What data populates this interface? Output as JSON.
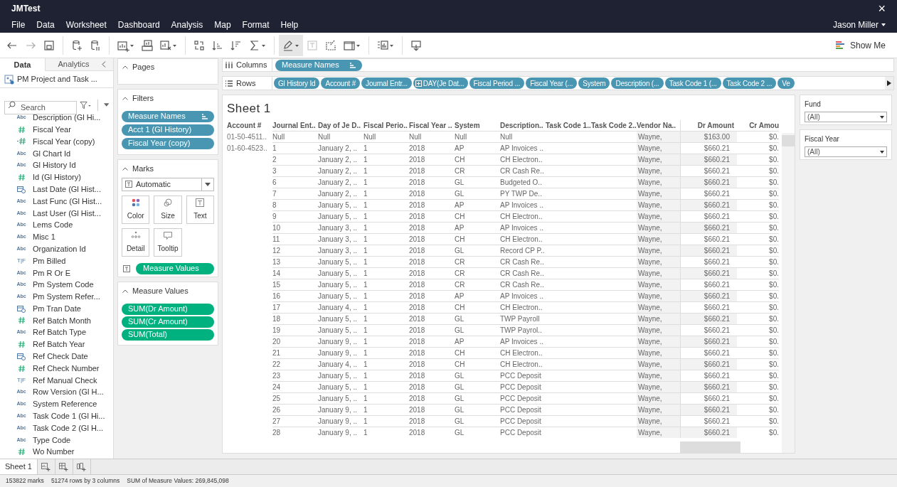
{
  "window": {
    "title": "JMTest",
    "close": "×"
  },
  "menu": [
    "File",
    "Data",
    "Worksheet",
    "Dashboard",
    "Analysis",
    "Map",
    "Format",
    "Help"
  ],
  "user": "Jason Miller",
  "show_me": "Show Me",
  "data_pane": {
    "tabs": [
      {
        "label": "Data",
        "selected": true
      },
      {
        "label": "Analytics",
        "selected": false
      }
    ],
    "datasource": "PM Project and Task ...",
    "search": {
      "placeholder": "Search"
    },
    "fields": [
      {
        "name": "Description (Gl Hi...",
        "kind": "string",
        "type_label": "Abc"
      },
      {
        "name": "Fiscal Year",
        "kind": "number"
      },
      {
        "name": "Fiscal Year (copy)",
        "kind": "calc"
      },
      {
        "name": "Gl Chart Id",
        "kind": "string",
        "type_label": "Abc"
      },
      {
        "name": "Gl History Id",
        "kind": "string",
        "type_label": "Abc"
      },
      {
        "name": "Id (Gl History)",
        "kind": "number"
      },
      {
        "name": "Last Date (Gl Hist...",
        "kind": "date"
      },
      {
        "name": "Last Func (Gl Hist...",
        "kind": "string",
        "type_label": "Abc"
      },
      {
        "name": "Last User (Gl Hist...",
        "kind": "string",
        "type_label": "Abc"
      },
      {
        "name": "Lems Code",
        "kind": "string",
        "type_label": "Abc"
      },
      {
        "name": "Misc 1",
        "kind": "string",
        "type_label": "Abc"
      },
      {
        "name": "Organization Id",
        "kind": "string",
        "type_label": "Abc"
      },
      {
        "name": "Pm Billed",
        "kind": "boolean",
        "type_label": "T|F"
      },
      {
        "name": "Pm R Or E",
        "kind": "string",
        "type_label": "Abc"
      },
      {
        "name": "Pm System Code",
        "kind": "string",
        "type_label": "Abc"
      },
      {
        "name": "Pm System Refer...",
        "kind": "string",
        "type_label": "Abc"
      },
      {
        "name": "Pm Tran Date",
        "kind": "date"
      },
      {
        "name": "Ref Batch Month",
        "kind": "number"
      },
      {
        "name": "Ref Batch Type",
        "kind": "string",
        "type_label": "Abc"
      },
      {
        "name": "Ref Batch Year",
        "kind": "number"
      },
      {
        "name": "Ref Check Date",
        "kind": "date"
      },
      {
        "name": "Ref Check Number",
        "kind": "number"
      },
      {
        "name": "Ref Manual Check",
        "kind": "boolean",
        "type_label": "T|F"
      },
      {
        "name": "Row Version (Gl H...",
        "kind": "string",
        "type_label": "Abc"
      },
      {
        "name": "System Reference",
        "kind": "string",
        "type_label": "Abc"
      },
      {
        "name": "Task Code 1 (Gl Hi...",
        "kind": "string",
        "type_label": "Abc"
      },
      {
        "name": "Task Code 2 (Gl H...",
        "kind": "string",
        "type_label": "Abc"
      },
      {
        "name": "Type Code",
        "kind": "string",
        "type_label": "Abc"
      },
      {
        "name": "Wo Number",
        "kind": "number"
      }
    ]
  },
  "pages": {
    "title": "Pages"
  },
  "filters": {
    "title": "Filters",
    "pills": [
      {
        "label": "Measure Names",
        "sorted": true
      },
      {
        "label": "Acct 1 (Gl History)",
        "sorted": false
      },
      {
        "label": "Fiscal Year (copy)",
        "sorted": false
      }
    ]
  },
  "marks": {
    "title": "Marks",
    "type": "Automatic",
    "buttons": [
      {
        "label": "Color",
        "kind": "color"
      },
      {
        "label": "Size",
        "kind": "size"
      },
      {
        "label": "Text",
        "kind": "text"
      },
      {
        "label": "Detail",
        "kind": "detail"
      },
      {
        "label": "Tooltip",
        "kind": "tooltip"
      }
    ],
    "pill": "Measure Values"
  },
  "measure_values": {
    "title": "Measure Values",
    "pills": [
      "SUM(Dr Amount)",
      "SUM(Cr Amount)",
      "SUM(Total)"
    ]
  },
  "columns_shelf": {
    "label": "Columns",
    "pills": [
      {
        "label": "Measure Names",
        "sorted": true
      }
    ]
  },
  "rows_shelf": {
    "label": "Rows",
    "pills": [
      {
        "label": "Gl History Id",
        "date": false
      },
      {
        "label": "Account #",
        "date": false
      },
      {
        "label": "Journal Entr...",
        "date": false
      },
      {
        "label": "DAY(Je Dat...",
        "date": true
      },
      {
        "label": "Fiscal Period ...",
        "date": false
      },
      {
        "label": "Fiscal Year (...",
        "date": false
      },
      {
        "label": "System",
        "date": false
      },
      {
        "label": "Description (...",
        "date": false
      },
      {
        "label": "Task Code 1 (...",
        "date": false
      },
      {
        "label": "Task Code 2 ...",
        "date": false
      },
      {
        "label": "Ve",
        "date": false
      }
    ]
  },
  "sheet": {
    "title": "Sheet 1",
    "columns": [
      "Account #",
      "Journal Ent..",
      "Day of Je D..",
      "Fiscal Perio..",
      "Fiscal Year ..",
      "System",
      "Description..",
      "Task Code 1..",
      "Task Code 2..",
      "Vendor Na..",
      "Dr Amount",
      "Cr Amou"
    ],
    "rows": [
      {
        "account": "01-50-4511..",
        "journal": "Null",
        "day": "Null",
        "period": "Null",
        "year": "Null",
        "system": "Null",
        "description": "Null",
        "vendor": "Wayne,",
        "dr": "$163.00",
        "cr": "$0."
      },
      {
        "account": "01-60-4523..",
        "journal": "1",
        "day": "January 2, ..",
        "period": "1",
        "year": "2018",
        "system": "AP",
        "description": "AP Invoices ..",
        "vendor": "Wayne,",
        "dr": "$660.21",
        "cr": "$0."
      },
      {
        "journal": "2",
        "day": "January 2, ..",
        "period": "1",
        "year": "2018",
        "system": "CH",
        "description": "CH Electron..",
        "vendor": "Wayne,",
        "dr": "$660.21",
        "cr": "$0."
      },
      {
        "journal": "3",
        "day": "January 2, ..",
        "period": "1",
        "year": "2018",
        "system": "CR",
        "description": "CR Cash Re..",
        "vendor": "Wayne,",
        "dr": "$660.21",
        "cr": "$0."
      },
      {
        "journal": "6",
        "day": "January 2, ..",
        "period": "1",
        "year": "2018",
        "system": "GL",
        "description": "Budgeted O..",
        "vendor": "Wayne,",
        "dr": "$660.21",
        "cr": "$0."
      },
      {
        "journal": "7",
        "day": "January 2, ..",
        "period": "1",
        "year": "2018",
        "system": "GL",
        "description": "PY TWP De..",
        "vendor": "Wayne,",
        "dr": "$660.21",
        "cr": "$0."
      },
      {
        "journal": "8",
        "day": "January 5, ..",
        "period": "1",
        "year": "2018",
        "system": "AP",
        "description": "AP Invoices ..",
        "vendor": "Wayne,",
        "dr": "$660.21",
        "cr": "$0."
      },
      {
        "journal": "9",
        "day": "January 5, ..",
        "period": "1",
        "year": "2018",
        "system": "CH",
        "description": "CH Electron..",
        "vendor": "Wayne,",
        "dr": "$660.21",
        "cr": "$0."
      },
      {
        "journal": "10",
        "day": "January 3, ..",
        "period": "1",
        "year": "2018",
        "system": "AP",
        "description": "AP Invoices ..",
        "vendor": "Wayne,",
        "dr": "$660.21",
        "cr": "$0."
      },
      {
        "journal": "11",
        "day": "January 3, ..",
        "period": "1",
        "year": "2018",
        "system": "CH",
        "description": "CH Electron..",
        "vendor": "Wayne,",
        "dr": "$660.21",
        "cr": "$0."
      },
      {
        "journal": "12",
        "day": "January 3, ..",
        "period": "1",
        "year": "2018",
        "system": "GL",
        "description": "Record CP P..",
        "vendor": "Wayne,",
        "dr": "$660.21",
        "cr": "$0."
      },
      {
        "journal": "13",
        "day": "January 5, ..",
        "period": "1",
        "year": "2018",
        "system": "CR",
        "description": "CR Cash Re..",
        "vendor": "Wayne,",
        "dr": "$660.21",
        "cr": "$0."
      },
      {
        "journal": "14",
        "day": "January 5, ..",
        "period": "1",
        "year": "2018",
        "system": "CR",
        "description": "CR Cash Re..",
        "vendor": "Wayne,",
        "dr": "$660.21",
        "cr": "$0."
      },
      {
        "journal": "15",
        "day": "January 5, ..",
        "period": "1",
        "year": "2018",
        "system": "CR",
        "description": "CR Cash Re..",
        "vendor": "Wayne,",
        "dr": "$660.21",
        "cr": "$0."
      },
      {
        "journal": "16",
        "day": "January 5, ..",
        "period": "1",
        "year": "2018",
        "system": "AP",
        "description": "AP Invoices ..",
        "vendor": "Wayne,",
        "dr": "$660.21",
        "cr": "$0."
      },
      {
        "journal": "17",
        "day": "January 4, ..",
        "period": "1",
        "year": "2018",
        "system": "CH",
        "description": "CH Electron..",
        "vendor": "Wayne,",
        "dr": "$660.21",
        "cr": "$0."
      },
      {
        "journal": "18",
        "day": "January 5, ..",
        "period": "1",
        "year": "2018",
        "system": "GL",
        "description": "TWP Payroll",
        "vendor": "Wayne,",
        "dr": "$660.21",
        "cr": "$0."
      },
      {
        "journal": "19",
        "day": "January 5, ..",
        "period": "1",
        "year": "2018",
        "system": "GL",
        "description": "TWP Payrol..",
        "vendor": "Wayne,",
        "dr": "$660.21",
        "cr": "$0."
      },
      {
        "journal": "20",
        "day": "January 9, ..",
        "period": "1",
        "year": "2018",
        "system": "AP",
        "description": "AP Invoices ..",
        "vendor": "Wayne,",
        "dr": "$660.21",
        "cr": "$0."
      },
      {
        "journal": "21",
        "day": "January 9, ..",
        "period": "1",
        "year": "2018",
        "system": "CH",
        "description": "CH Electron..",
        "vendor": "Wayne,",
        "dr": "$660.21",
        "cr": "$0."
      },
      {
        "journal": "22",
        "day": "January 4, ..",
        "period": "1",
        "year": "2018",
        "system": "CH",
        "description": "CH Electron..",
        "vendor": "Wayne,",
        "dr": "$660.21",
        "cr": "$0."
      },
      {
        "journal": "23",
        "day": "January 5, ..",
        "period": "1",
        "year": "2018",
        "system": "GL",
        "description": "PCC Deposit",
        "vendor": "Wayne,",
        "dr": "$660.21",
        "cr": "$0."
      },
      {
        "journal": "24",
        "day": "January 5, ..",
        "period": "1",
        "year": "2018",
        "system": "GL",
        "description": "PCC Deposit",
        "vendor": "Wayne,",
        "dr": "$660.21",
        "cr": "$0."
      },
      {
        "journal": "25",
        "day": "January 5, ..",
        "period": "1",
        "year": "2018",
        "system": "GL",
        "description": "PCC Deposit",
        "vendor": "Wayne,",
        "dr": "$660.21",
        "cr": "$0."
      },
      {
        "journal": "26",
        "day": "January 9, ..",
        "period": "1",
        "year": "2018",
        "system": "GL",
        "description": "PCC Deposit",
        "vendor": "Wayne,",
        "dr": "$660.21",
        "cr": "$0."
      },
      {
        "journal": "27",
        "day": "January 9, ..",
        "period": "1",
        "year": "2018",
        "system": "GL",
        "description": "PCC Deposit",
        "vendor": "Wayne,",
        "dr": "$660.21",
        "cr": "$0."
      },
      {
        "journal": "28",
        "day": "January 9, ..",
        "period": "1",
        "year": "2018",
        "system": "GL",
        "description": "PCC Deposit",
        "vendor": "Wayne,",
        "dr": "$660.21",
        "cr": "$0."
      }
    ]
  },
  "quick_filters": [
    {
      "title": "Fund",
      "value": "(All)"
    },
    {
      "title": "Fiscal Year",
      "value": "(All)"
    }
  ],
  "sheet_tabs": [
    {
      "label": "Sheet 1",
      "selected": true
    }
  ],
  "status_bar": [
    "153822 marks",
    "51274 rows by 3 columns",
    "SUM of Measure Values: 269,845,098"
  ]
}
